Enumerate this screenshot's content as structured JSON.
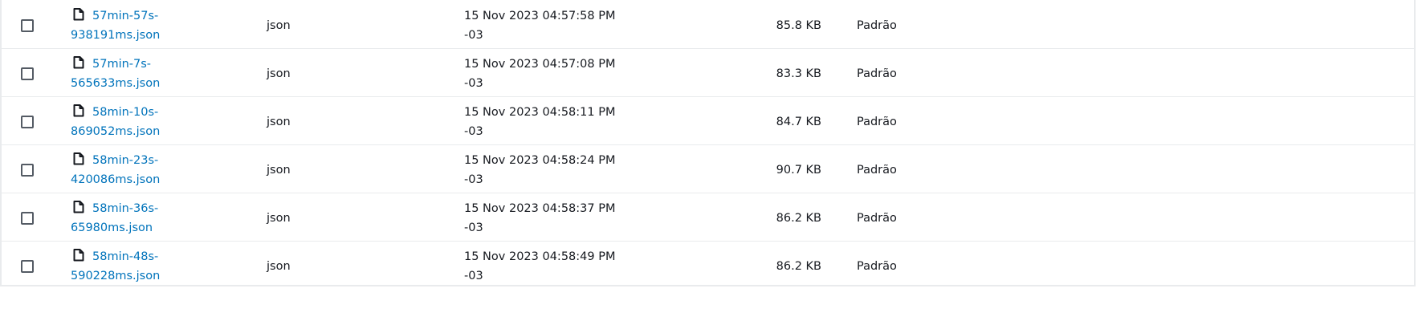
{
  "colors": {
    "link": "#0073bb",
    "text": "#16191f",
    "border": "#e9ebed",
    "checkbox_border": "#545b64"
  },
  "rows": [
    {
      "name_line1": "57min-57s-",
      "name_line2": "938191ms.json",
      "type": "json",
      "date_line1": "15 Nov 2023 04:57:58 PM",
      "date_line2": "-03",
      "size": "85.8 KB",
      "storage_class": "Padrão",
      "icon": "file-icon"
    },
    {
      "name_line1": "57min-7s-",
      "name_line2": "565633ms.json",
      "type": "json",
      "date_line1": "15 Nov 2023 04:57:08 PM",
      "date_line2": "-03",
      "size": "83.3 KB",
      "storage_class": "Padrão",
      "icon": "file-icon"
    },
    {
      "name_line1": "58min-10s-",
      "name_line2": "869052ms.json",
      "type": "json",
      "date_line1": "15 Nov 2023 04:58:11 PM",
      "date_line2": "-03",
      "size": "84.7 KB",
      "storage_class": "Padrão",
      "icon": "file-icon"
    },
    {
      "name_line1": "58min-23s-",
      "name_line2": "420086ms.json",
      "type": "json",
      "date_line1": "15 Nov 2023 04:58:24 PM",
      "date_line2": "-03",
      "size": "90.7 KB",
      "storage_class": "Padrão",
      "icon": "file-icon"
    },
    {
      "name_line1": "58min-36s-",
      "name_line2": "65980ms.json",
      "type": "json",
      "date_line1": "15 Nov 2023 04:58:37 PM",
      "date_line2": "-03",
      "size": "86.2 KB",
      "storage_class": "Padrão",
      "icon": "file-icon"
    },
    {
      "name_line1": "58min-48s-",
      "name_line2": "590228ms.json",
      "type": "json",
      "date_line1": "15 Nov 2023 04:58:49 PM",
      "date_line2": "-03",
      "size": "86.2 KB",
      "storage_class": "Padrão",
      "icon": "file-icon"
    }
  ]
}
